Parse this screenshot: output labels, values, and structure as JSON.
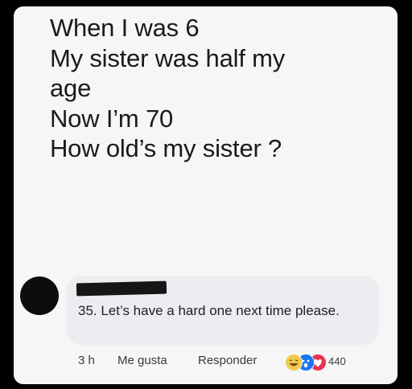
{
  "post": {
    "lines": [
      "When I was 6",
      "My sister was half my",
      "age",
      "Now I’m 70",
      "How old’s my sister ?"
    ]
  },
  "comment": {
    "text": "35. Let’s have a hard one next time please.",
    "time": "3 h",
    "like_label": "Me gusta",
    "reply_label": "Responder",
    "reaction_count": "440",
    "reactions": [
      "haha-icon",
      "wow-icon",
      "love-icon"
    ]
  },
  "colors": {
    "card_bg": "#f6f6f6",
    "bubble_bg": "#ebedf1",
    "haha": "#f2c94c",
    "wow": "#1877f2",
    "love": "#e8344e"
  }
}
